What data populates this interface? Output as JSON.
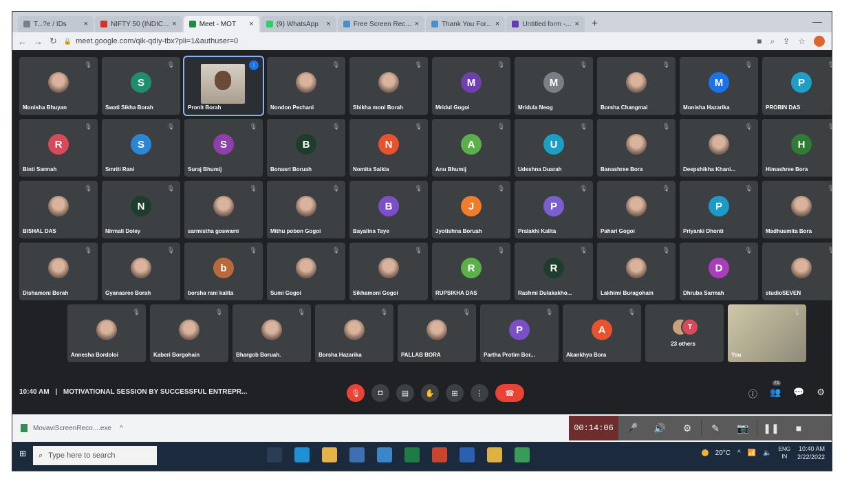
{
  "browser": {
    "tabs": [
      {
        "label": "T...?e / IDs",
        "color": "#7a8088",
        "active": false
      },
      {
        "label": "NIFTY 50 (INDIC...",
        "color": "#d93025",
        "active": false
      },
      {
        "label": "Meet - MOT",
        "color": "#1e8e3e",
        "active": true
      },
      {
        "label": "(9) WhatsApp",
        "color": "#25d366",
        "active": false
      },
      {
        "label": "Free Screen Rec...",
        "color": "#4a90c8",
        "active": false
      },
      {
        "label": "Thank You For...",
        "color": "#4a90c8",
        "active": false
      },
      {
        "label": "Untitled form -...",
        "color": "#673ab7",
        "active": false
      }
    ],
    "new_tab_label": "+",
    "url": "meet.google.com/qik-qdiy-tbx?pli=1&authuser=0"
  },
  "meet": {
    "rows": [
      [
        {
          "name": "Monisha Bhuyan",
          "initial": "",
          "color": "",
          "photo": true
        },
        {
          "name": "Swati Sikha Borah",
          "initial": "S",
          "color": "#1e8e6e"
        },
        {
          "name": "Pronit Borah",
          "initial": "",
          "color": "",
          "video": true,
          "speaking": true
        },
        {
          "name": "Nondon Pechani",
          "initial": "",
          "color": "",
          "photo": true
        },
        {
          "name": "Shikha moni Borah",
          "initial": "",
          "color": "",
          "photo": true
        },
        {
          "name": "Mridul Gogoi",
          "initial": "M",
          "color": "#6f3fb0"
        },
        {
          "name": "Mridula Neog",
          "initial": "M",
          "color": "#7a7f86"
        },
        {
          "name": "Borsha Changmai",
          "initial": "",
          "color": "",
          "photo": true
        },
        {
          "name": "Monisha Hazarika",
          "initial": "M",
          "color": "#1a73e8"
        },
        {
          "name": "PROBIN DAS",
          "initial": "P",
          "color": "#1ea0c6"
        }
      ],
      [
        {
          "name": "Binti Sarmah",
          "initial": "R",
          "color": "#d84a5a"
        },
        {
          "name": "Smriti Rani",
          "initial": "S",
          "color": "#2a86d6"
        },
        {
          "name": "Suraj Bhumij",
          "initial": "S",
          "color": "#8e3fa8"
        },
        {
          "name": "Bonasri Boruah",
          "initial": "B",
          "color": "#1f3d2f"
        },
        {
          "name": "Nomita Saikia",
          "initial": "N",
          "color": "#e8532e"
        },
        {
          "name": "Anu Bhumij",
          "initial": "A",
          "color": "#5bb04a"
        },
        {
          "name": "Udeshna Duarah",
          "initial": "U",
          "color": "#1aa0c4"
        },
        {
          "name": "Banashree Bora",
          "initial": "",
          "color": "",
          "photo": true
        },
        {
          "name": "Deepshikha Khani...",
          "initial": "",
          "color": "",
          "photo": true
        },
        {
          "name": "Himashree Bora",
          "initial": "H",
          "color": "#2e7d32"
        }
      ],
      [
        {
          "name": "BISHAL DAS",
          "initial": "",
          "color": "",
          "photo": true
        },
        {
          "name": "Nirmali Doley",
          "initial": "N",
          "color": "#1f3d2f"
        },
        {
          "name": "sarmistha goswami",
          "initial": "",
          "color": "",
          "photo": true
        },
        {
          "name": "Mithu pobon Gogoi",
          "initial": "",
          "color": "",
          "photo": true
        },
        {
          "name": "Bayalina Taye",
          "initial": "B",
          "color": "#7b4fc8"
        },
        {
          "name": "Jyotishna Boruah",
          "initial": "J",
          "color": "#f07d2c"
        },
        {
          "name": "Pralakhi Kalita",
          "initial": "P",
          "color": "#7b5fd0"
        },
        {
          "name": "Pahari Gogoi",
          "initial": "",
          "color": "",
          "photo": true
        },
        {
          "name": "Priyanki Dhonti",
          "initial": "P",
          "color": "#1a9bc8"
        },
        {
          "name": "Madhusmita Bora",
          "initial": "",
          "color": "",
          "photo": true
        }
      ],
      [
        {
          "name": "Dishamoni Borah",
          "initial": "",
          "color": "",
          "photo": true
        },
        {
          "name": "Gyanasree Borah",
          "initial": "",
          "color": "",
          "photo": true
        },
        {
          "name": "borsha rani kalita",
          "initial": "b",
          "color": "#b86a3a"
        },
        {
          "name": "Sumi Gogoi",
          "initial": "",
          "color": "",
          "photo": true
        },
        {
          "name": "Sikhamoni Gogoi",
          "initial": "",
          "color": "",
          "photo": true
        },
        {
          "name": "RUPSIKHA DAS",
          "initial": "R",
          "color": "#5bb04a"
        },
        {
          "name": "Rashmi Dulakakho...",
          "initial": "R",
          "color": "#1f3d2f"
        },
        {
          "name": "Lakhimi Buragohain",
          "initial": "",
          "color": "",
          "photo": true
        },
        {
          "name": "Dhruba Sarmah",
          "initial": "D",
          "color": "#a83fb8"
        },
        {
          "name": "studioSEVEN",
          "initial": "",
          "color": "",
          "photo": true
        }
      ],
      [
        {
          "name": "Annesha Bordoloi",
          "initial": "",
          "color": "",
          "photo": true
        },
        {
          "name": "Kaberi Borgohain",
          "initial": "",
          "color": "",
          "photo": true
        },
        {
          "name": "Bhargob Boruah.",
          "initial": "",
          "color": "",
          "photo": true
        },
        {
          "name": "Borsha Hazarika",
          "initial": "",
          "color": "",
          "photo": true
        },
        {
          "name": "PALLAB BORA",
          "initial": "",
          "color": "",
          "photo": true
        },
        {
          "name": "Partha Protim Bor...",
          "initial": "P",
          "color": "#7b4fc8"
        },
        {
          "name": "Akankhya Bora",
          "initial": "A",
          "color": "#e8532e"
        },
        {
          "name": "23 others",
          "initial": "",
          "color": "",
          "others": true,
          "others_initials": [
            "",
            "T"
          ],
          "others_colors": [
            "#c9a27a",
            "#d84a5a"
          ]
        },
        {
          "name": "You",
          "initial": "",
          "color": "",
          "presenter": true
        }
      ]
    ],
    "time": "10:40 AM",
    "separator": "|",
    "meeting_title": "MOTIVATIONAL SESSION BY SUCCESSFUL ENTREPR...",
    "people_count": "71"
  },
  "downloads": {
    "file": "MovaviScreenReco....exe",
    "chevron": "^"
  },
  "recorder": {
    "timer": "00:14:06"
  },
  "taskbar": {
    "search_placeholder": "Type here to search",
    "weather": "20°C",
    "lang_top": "ENG",
    "lang_bottom": "IN",
    "clock_time": "10:40 AM",
    "clock_date": "2/22/2022"
  }
}
